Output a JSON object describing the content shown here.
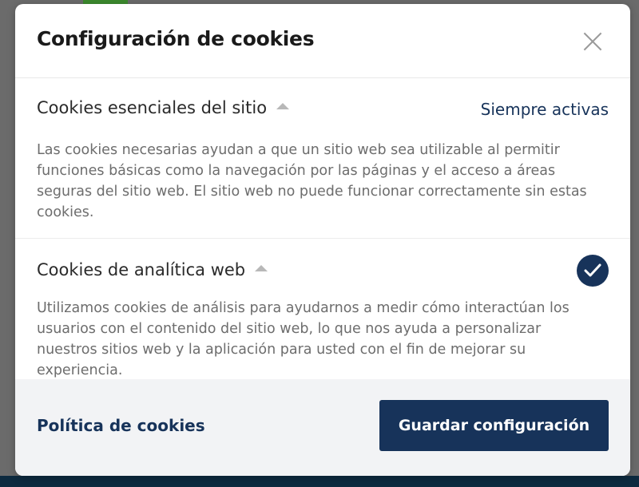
{
  "modal": {
    "title": "Configuración de cookies",
    "close_icon": "close-icon"
  },
  "sections": [
    {
      "title": "Cookies esenciales del sitio",
      "status": "Siempre activas",
      "description": "Las cookies necesarias ayudan a que un sitio web sea utilizable al permitir funciones básicas como la navegación por las páginas y el acceso a áreas seguras del sitio web. El sitio web no puede funcionar correctamente sin estas cookies."
    },
    {
      "title": "Cookies de analítica web",
      "checked": true,
      "description": "Utilizamos cookies de análisis para ayudarnos a medir cómo interactúan los usuarios con el contenido del sitio web, lo que nos ayuda a personalizar nuestros sitios web y la aplicación para usted con el fin de mejorar su experiencia."
    }
  ],
  "footer": {
    "policy_link": "Política de cookies",
    "save_label": "Guardar configuración"
  },
  "colors": {
    "primary": "#17335a",
    "overlay": "#6b6b6b",
    "footer_bg": "#f2f3f5"
  }
}
